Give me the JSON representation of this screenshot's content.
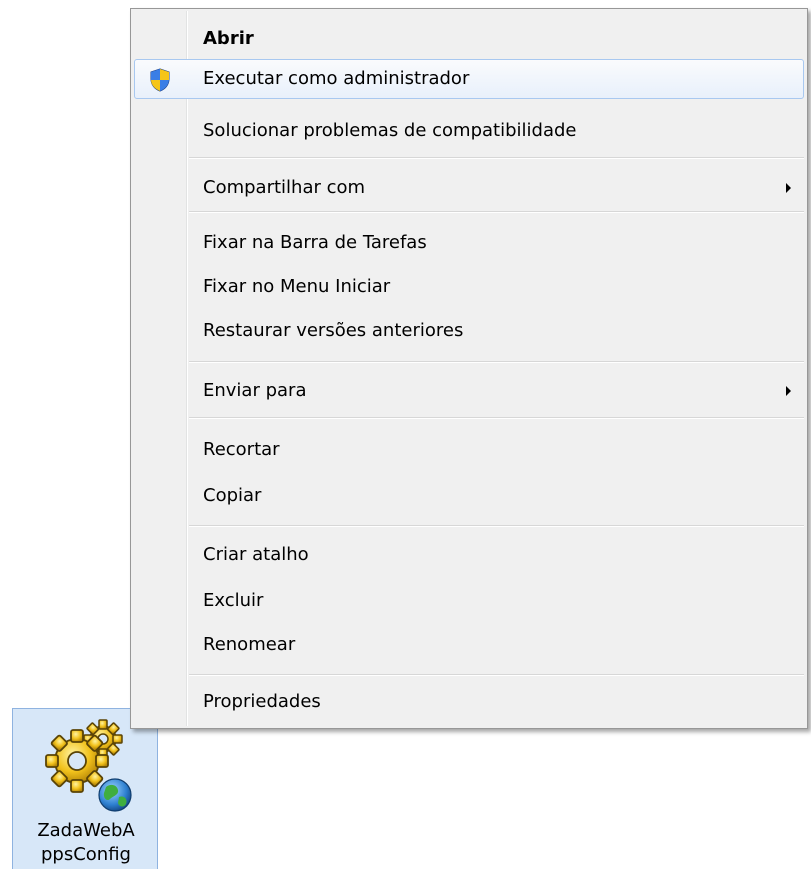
{
  "context_menu": {
    "items": [
      {
        "label": "Abrir"
      },
      {
        "label": "Executar como administrador",
        "icon": "uac-shield-icon"
      },
      {
        "label": "Solucionar problemas de compatibilidade"
      },
      {
        "label": "Compartilhar com",
        "submenu": true
      },
      {
        "label": "Fixar na Barra de Tarefas"
      },
      {
        "label": "Fixar no Menu Iniciar"
      },
      {
        "label": "Restaurar versões anteriores"
      },
      {
        "label": "Enviar para",
        "submenu": true
      },
      {
        "label": "Recortar"
      },
      {
        "label": "Copiar"
      },
      {
        "label": "Criar atalho"
      },
      {
        "label": "Excluir"
      },
      {
        "label": "Renomear"
      },
      {
        "label": "Propriedades"
      }
    ],
    "default_item": "Abrir",
    "hovered_item": "Executar como administrador"
  },
  "desktop_icon": {
    "label": "ZadaWebA\nppsConfig",
    "icon": "gear-globe-icon",
    "selected": true
  },
  "colors": {
    "menu_background": "#f0f0f0",
    "highlight_border": "#a8c8f0",
    "icon_selection": "#d7e7f8"
  }
}
